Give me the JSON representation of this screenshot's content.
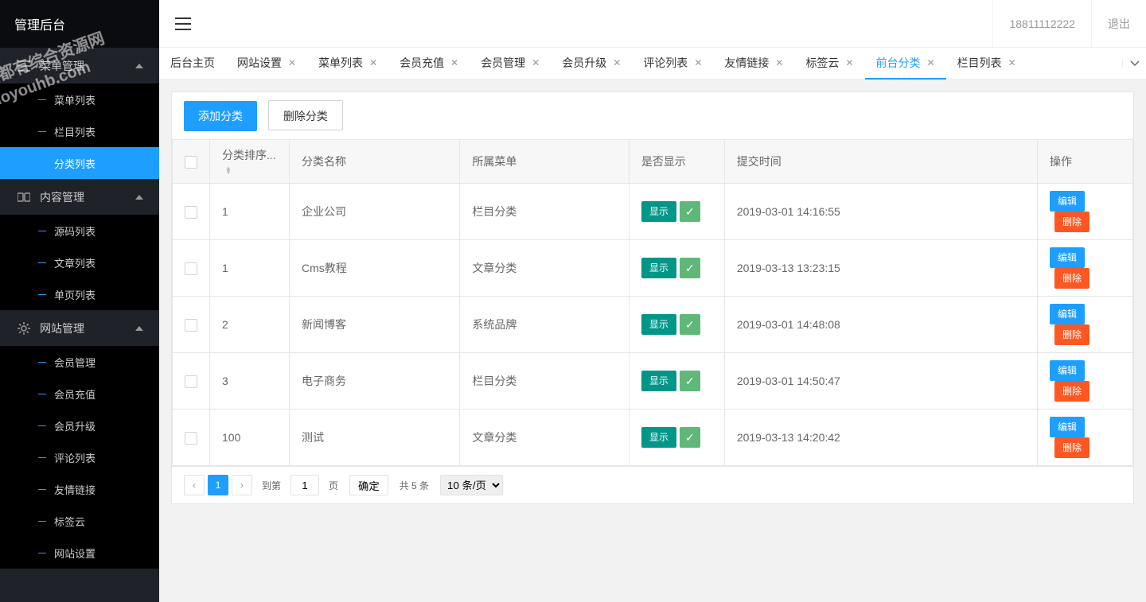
{
  "logo_title": "管理后台",
  "header": {
    "user_phone": "18811112222",
    "logout": "退出"
  },
  "sidebar": {
    "groups": [
      {
        "title": "菜单管理",
        "items": [
          {
            "label": "菜单列表"
          },
          {
            "label": "栏目列表"
          },
          {
            "label": "分类列表",
            "active": true
          }
        ]
      },
      {
        "title": "内容管理",
        "items": [
          {
            "label": "源码列表"
          },
          {
            "label": "文章列表"
          },
          {
            "label": "单页列表"
          }
        ]
      },
      {
        "title": "网站管理",
        "items": [
          {
            "label": "会员管理"
          },
          {
            "label": "会员充值"
          },
          {
            "label": "会员升级"
          },
          {
            "label": "评论列表"
          },
          {
            "label": "友情链接"
          },
          {
            "label": "标签云"
          },
          {
            "label": "网站设置"
          }
        ]
      }
    ]
  },
  "tabs": [
    {
      "label": "后台主页",
      "closable": false
    },
    {
      "label": "网站设置",
      "closable": true
    },
    {
      "label": "菜单列表",
      "closable": true
    },
    {
      "label": "会员充值",
      "closable": true
    },
    {
      "label": "会员管理",
      "closable": true
    },
    {
      "label": "会员升级",
      "closable": true
    },
    {
      "label": "评论列表",
      "closable": true
    },
    {
      "label": "友情链接",
      "closable": true
    },
    {
      "label": "标签云",
      "closable": true
    },
    {
      "label": "前台分类",
      "closable": true,
      "active": true
    },
    {
      "label": "栏目列表",
      "closable": true
    }
  ],
  "toolbar": {
    "add_label": "添加分类",
    "delete_label": "删除分类"
  },
  "table": {
    "columns": {
      "sort": "分类排序...",
      "name": "分类名称",
      "menu": "所属菜单",
      "display": "是否显示",
      "time": "提交时间",
      "action": "操作"
    },
    "display_tag": "显示",
    "edit_label": "编辑",
    "delete_label": "删除",
    "rows": [
      {
        "sort": "1",
        "name": "企业公司",
        "menu": "栏目分类",
        "time": "2019-03-01 14:16:55"
      },
      {
        "sort": "1",
        "name": "Cms教程",
        "menu": "文章分类",
        "time": "2019-03-13 13:23:15"
      },
      {
        "sort": "2",
        "name": "新闻博客",
        "menu": "系统品牌",
        "time": "2019-03-01 14:48:08"
      },
      {
        "sort": "3",
        "name": "电子商务",
        "menu": "栏目分类",
        "time": "2019-03-01 14:50:47"
      },
      {
        "sort": "100",
        "name": "测试",
        "menu": "文章分类",
        "time": "2019-03-13 14:20:42"
      }
    ]
  },
  "pagination": {
    "current_page": "1",
    "goto_label_prefix": "到第",
    "goto_input_value": "1",
    "goto_label_suffix": "页",
    "confirm_label": "确定",
    "total_label": "共 5 条",
    "page_size_label": "10 条/页"
  },
  "watermark": {
    "line1": "全都有综合资源网",
    "line2": "doyouhb.com"
  }
}
